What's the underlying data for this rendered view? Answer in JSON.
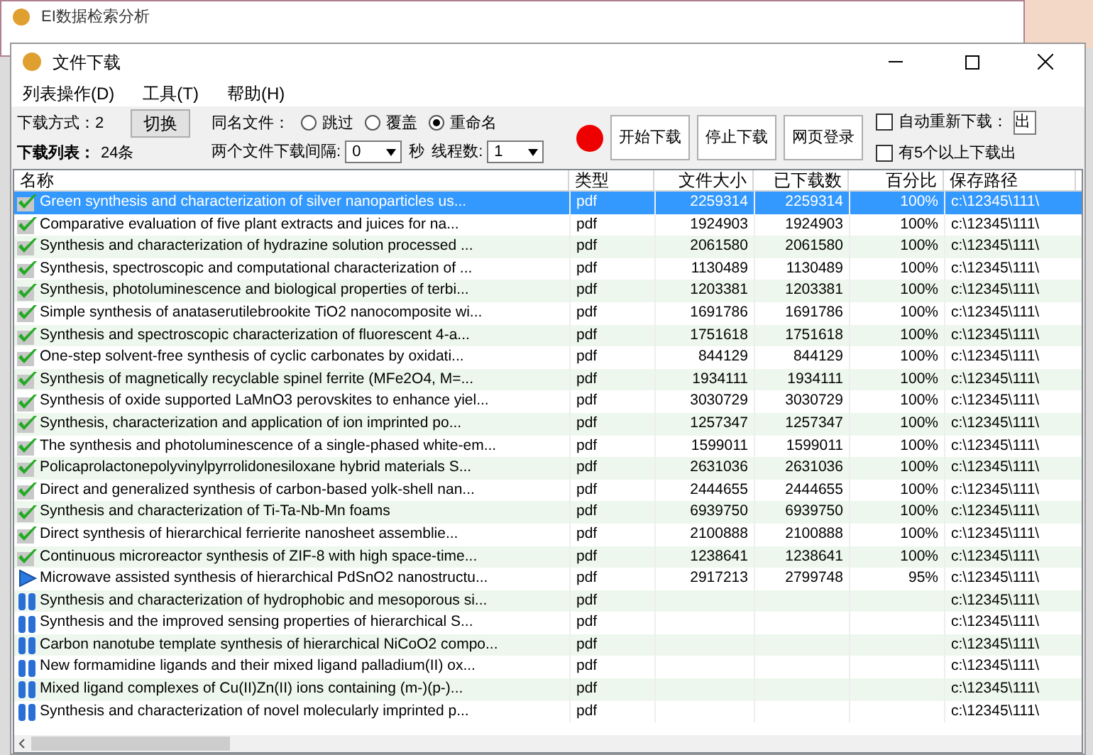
{
  "background_window": {
    "title": "EI数据检索分析"
  },
  "window": {
    "title": "文件下载"
  },
  "menu": [
    "列表操作(D)",
    "工具(T)",
    "帮助(H)"
  ],
  "toolbar": {
    "mode_label": "下载方式：2",
    "switch_button": "切换",
    "count_label": "下载列表：",
    "count_value": "24条",
    "same_name_label": "同名文件：",
    "same_name_options": [
      {
        "label": "跳过",
        "selected": false
      },
      {
        "label": "覆盖",
        "selected": false
      },
      {
        "label": "重命名",
        "selected": true
      }
    ],
    "interval_label": "两个文件下载间隔:",
    "interval_value": "0",
    "seconds_label": "秒",
    "threads_label": "线程数:",
    "threads_value": "1",
    "buttons": [
      "开始下载",
      "停止下载",
      "网页登录"
    ],
    "auto_retry": {
      "label": "自动重新下载：",
      "checked": false,
      "value": "出"
    },
    "error_option": {
      "label": "有5个以上下载出",
      "checked": false
    }
  },
  "table": {
    "columns": [
      "名称",
      "类型",
      "文件大小",
      "已下载数",
      "百分比",
      "保存路径"
    ],
    "rows": [
      {
        "kind": "done",
        "selected": true,
        "name": "Green synthesis and characterization of silver nanoparticles us...",
        "type": "pdf",
        "size": "2259314",
        "downloaded": "2259314",
        "percent": "100%",
        "path": "c:\\12345\\111\\"
      },
      {
        "kind": "done",
        "selected": false,
        "name": "Comparative evaluation of five plant extracts and juices for na...",
        "type": "pdf",
        "size": "1924903",
        "downloaded": "1924903",
        "percent": "100%",
        "path": "c:\\12345\\111\\"
      },
      {
        "kind": "done",
        "selected": false,
        "name": "Synthesis and characterization of hydrazine solution processed ...",
        "type": "pdf",
        "size": "2061580",
        "downloaded": "2061580",
        "percent": "100%",
        "path": "c:\\12345\\111\\"
      },
      {
        "kind": "done",
        "selected": false,
        "name": "Synthesis, spectroscopic and computational characterization of ...",
        "type": "pdf",
        "size": "1130489",
        "downloaded": "1130489",
        "percent": "100%",
        "path": "c:\\12345\\111\\"
      },
      {
        "kind": "done",
        "selected": false,
        "name": "Synthesis, photoluminescence and biological properties of terbi...",
        "type": "pdf",
        "size": "1203381",
        "downloaded": "1203381",
        "percent": "100%",
        "path": "c:\\12345\\111\\"
      },
      {
        "kind": "done",
        "selected": false,
        "name": "Simple synthesis of anataserutilebrookite TiO2 nanocomposite wi...",
        "type": "pdf",
        "size": "1691786",
        "downloaded": "1691786",
        "percent": "100%",
        "path": "c:\\12345\\111\\"
      },
      {
        "kind": "done",
        "selected": false,
        "name": "Synthesis and spectroscopic characterization of fluorescent 4-a...",
        "type": "pdf",
        "size": "1751618",
        "downloaded": "1751618",
        "percent": "100%",
        "path": "c:\\12345\\111\\"
      },
      {
        "kind": "done",
        "selected": false,
        "name": "One-step solvent-free synthesis of cyclic carbonates by oxidati...",
        "type": "pdf",
        "size": "844129",
        "downloaded": "844129",
        "percent": "100%",
        "path": "c:\\12345\\111\\"
      },
      {
        "kind": "done",
        "selected": false,
        "name": "Synthesis of magnetically recyclable spinel ferrite (MFe2O4, M=...",
        "type": "pdf",
        "size": "1934111",
        "downloaded": "1934111",
        "percent": "100%",
        "path": "c:\\12345\\111\\"
      },
      {
        "kind": "done",
        "selected": false,
        "name": "Synthesis of oxide supported LaMnO3 perovskites to enhance yiel...",
        "type": "pdf",
        "size": "3030729",
        "downloaded": "3030729",
        "percent": "100%",
        "path": "c:\\12345\\111\\"
      },
      {
        "kind": "done",
        "selected": false,
        "name": "Synthesis, characterization and application of ion imprinted po...",
        "type": "pdf",
        "size": "1257347",
        "downloaded": "1257347",
        "percent": "100%",
        "path": "c:\\12345\\111\\"
      },
      {
        "kind": "done",
        "selected": false,
        "name": "The synthesis and photoluminescence of a single-phased white-em...",
        "type": "pdf",
        "size": "1599011",
        "downloaded": "1599011",
        "percent": "100%",
        "path": "c:\\12345\\111\\"
      },
      {
        "kind": "done",
        "selected": false,
        "name": "Policaprolactonepolyvinylpyrrolidonesiloxane hybrid materials S...",
        "type": "pdf",
        "size": "2631036",
        "downloaded": "2631036",
        "percent": "100%",
        "path": "c:\\12345\\111\\"
      },
      {
        "kind": "done",
        "selected": false,
        "name": "Direct and generalized synthesis of carbon-based yolk-shell nan...",
        "type": "pdf",
        "size": "2444655",
        "downloaded": "2444655",
        "percent": "100%",
        "path": "c:\\12345\\111\\"
      },
      {
        "kind": "done",
        "selected": false,
        "name": "Synthesis and characterization of Ti-Ta-Nb-Mn foams",
        "type": "pdf",
        "size": "6939750",
        "downloaded": "6939750",
        "percent": "100%",
        "path": "c:\\12345\\111\\"
      },
      {
        "kind": "done",
        "selected": false,
        "name": "Direct synthesis of hierarchical ferrierite nanosheet assemblie...",
        "type": "pdf",
        "size": "2100888",
        "downloaded": "2100888",
        "percent": "100%",
        "path": "c:\\12345\\111\\"
      },
      {
        "kind": "done",
        "selected": false,
        "name": "Continuous microreactor synthesis of ZIF-8 with high space-time...",
        "type": "pdf",
        "size": "1238641",
        "downloaded": "1238641",
        "percent": "100%",
        "path": "c:\\12345\\111\\"
      },
      {
        "kind": "downloading",
        "selected": false,
        "name": "Microwave assisted synthesis of hierarchical PdSnO2 nanostructu...",
        "type": "pdf",
        "size": "2917213",
        "downloaded": "2799748",
        "percent": "95%",
        "path": "c:\\12345\\111\\"
      },
      {
        "kind": "paused",
        "selected": false,
        "name": "Synthesis and characterization of hydrophobic and mesoporous si...",
        "type": "pdf",
        "path": "c:\\12345\\111\\"
      },
      {
        "kind": "paused",
        "selected": false,
        "name": "Synthesis and the improved sensing properties of hierarchical S...",
        "type": "pdf",
        "path": "c:\\12345\\111\\"
      },
      {
        "kind": "paused",
        "selected": false,
        "name": "Carbon nanotube template synthesis of hierarchical NiCoO2 compo...",
        "type": "pdf",
        "path": "c:\\12345\\111\\"
      },
      {
        "kind": "paused",
        "selected": false,
        "name": "New formamidine ligands and their mixed ligand palladium(II) ox...",
        "type": "pdf",
        "path": "c:\\12345\\111\\"
      },
      {
        "kind": "paused",
        "selected": false,
        "name": "Mixed ligand complexes of Cu(II)Zn(II) ions containing (m-)(p-)...",
        "type": "pdf",
        "path": "c:\\12345\\111\\"
      },
      {
        "kind": "paused",
        "selected": false,
        "name": "Synthesis and characterization of novel molecularly imprinted p...",
        "type": "pdf",
        "path": "c:\\12345\\111\\"
      }
    ]
  }
}
